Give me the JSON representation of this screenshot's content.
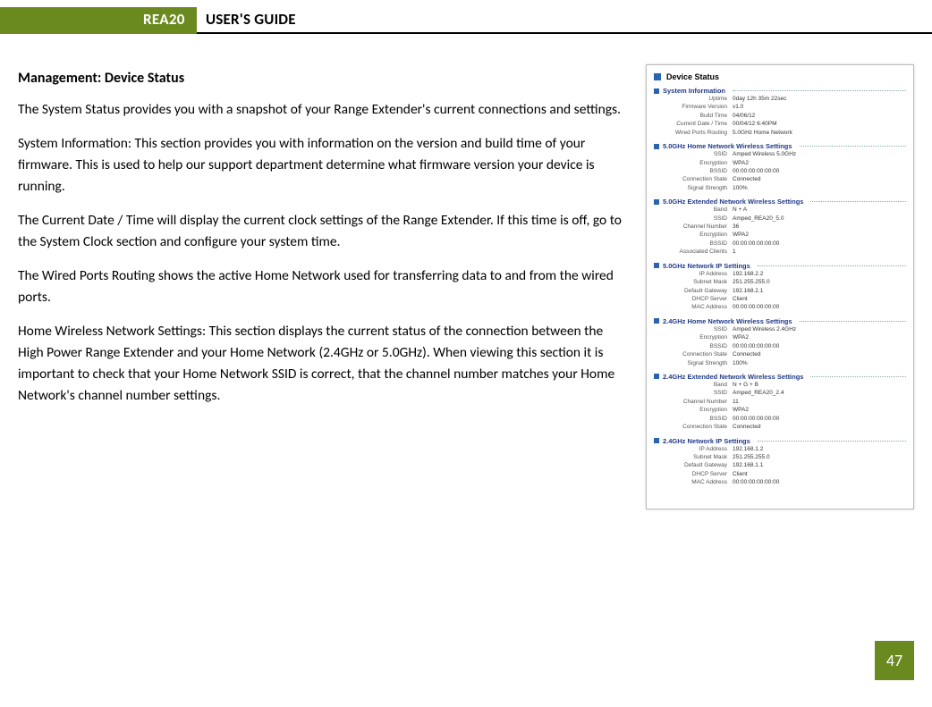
{
  "header": {
    "product": "REA20",
    "doc_title": "USER'S GUIDE"
  },
  "section_title": "Management: Device Status",
  "paragraphs": [
    "The System Status provides you with a snapshot of your Range Extender's current connections and settings.",
    "System Information: This section provides you with information on the version and build time of your firmware. This is used to help our support department determine what firmware version your device is running.",
    "The Current Date / Time will display the current clock settings of the Range Extender.  If this time is off, go to the System Clock section and configure your system time.",
    "The Wired Ports Routing shows the active Home Network used for transferring data to and from the wired ports.",
    "Home Wireless Network Settings: This section displays the current status of the connection between the High Power Range Extender and your Home Network (2.4GHz or 5.0GHz). When viewing this section it is important to check that your Home Network SSID is correct, that the channel number matches your Home Network's channel number settings."
  ],
  "thumbnail": {
    "title": "Device Status",
    "sections": [
      {
        "name": "System Information",
        "rows": [
          {
            "k": "Uptime",
            "v": "0day 12h 35m 22sec"
          },
          {
            "k": "Firmware Version",
            "v": "v1.0"
          },
          {
            "k": "Build Time",
            "v": "04/06/12"
          },
          {
            "k": "Current Date / Time",
            "v": "00/04/12 6:40PM"
          },
          {
            "k": "Wired Ports Routing",
            "v": "5.0GHz Home Network"
          }
        ]
      },
      {
        "name": "5.0GHz Home Network Wireless Settings",
        "rows": [
          {
            "k": "SSID",
            "v": "Amped Wireless 5.0GHz"
          },
          {
            "k": "Encryption",
            "v": "WPA2"
          },
          {
            "k": "BSSID",
            "v": "00:00:00:00:00:00"
          },
          {
            "k": "Connection State",
            "v": "Connected"
          },
          {
            "k": "Signal Strength",
            "v": "100%"
          }
        ]
      },
      {
        "name": "5.0GHz Extended Network Wireless Settings",
        "rows": [
          {
            "k": "Band",
            "v": "N + A"
          },
          {
            "k": "SSID",
            "v": "Amped_REA20_5.0"
          },
          {
            "k": "Channel Number",
            "v": "36"
          },
          {
            "k": "Encryption",
            "v": "WPA2"
          },
          {
            "k": "BSSID",
            "v": "00:00:00:00:00:00"
          },
          {
            "k": "Associated Clients",
            "v": "1"
          }
        ]
      },
      {
        "name": "5.0GHz Network IP Settings",
        "rows": [
          {
            "k": "IP Address",
            "v": "192.168.2.2"
          },
          {
            "k": "Subnet Mask",
            "v": "251.255.255.0"
          },
          {
            "k": "Default Gateway",
            "v": "192.168.2.1"
          },
          {
            "k": "DHCP Server",
            "v": "Client"
          },
          {
            "k": "MAC Address",
            "v": "00:00:00:00:00:00"
          }
        ]
      },
      {
        "name": "2.4GHz Home Network Wireless Settings",
        "rows": [
          {
            "k": "SSID",
            "v": "Amped Wireless 2.4GHz"
          },
          {
            "k": "Encryption",
            "v": "WPA2"
          },
          {
            "k": "BSSID",
            "v": "00:00:00:00:00:00"
          },
          {
            "k": "Connection State",
            "v": "Connected"
          },
          {
            "k": "Signal Strength",
            "v": "100%"
          }
        ]
      },
      {
        "name": "2.4GHz Extended Network Wireless Settings",
        "rows": [
          {
            "k": "Band",
            "v": "N + G + B"
          },
          {
            "k": "SSID",
            "v": "Amped_REA20_2.4"
          },
          {
            "k": "Channel Number",
            "v": "11"
          },
          {
            "k": "Encryption",
            "v": "WPA2"
          },
          {
            "k": "BSSID",
            "v": "00:00:00:00:00:00"
          },
          {
            "k": "Connection State",
            "v": "Connected"
          }
        ]
      },
      {
        "name": "2.4GHz Network IP Settings",
        "rows": [
          {
            "k": "IP Address",
            "v": "192.168.1.2"
          },
          {
            "k": "Subnet Mask",
            "v": "251.255.255.0"
          },
          {
            "k": "Default Gateway",
            "v": "192.168.1.1"
          },
          {
            "k": "DHCP Server",
            "v": "Client"
          },
          {
            "k": "MAC Address",
            "v": "00:00:00:00:00:00"
          }
        ]
      }
    ]
  },
  "page_number": "47"
}
